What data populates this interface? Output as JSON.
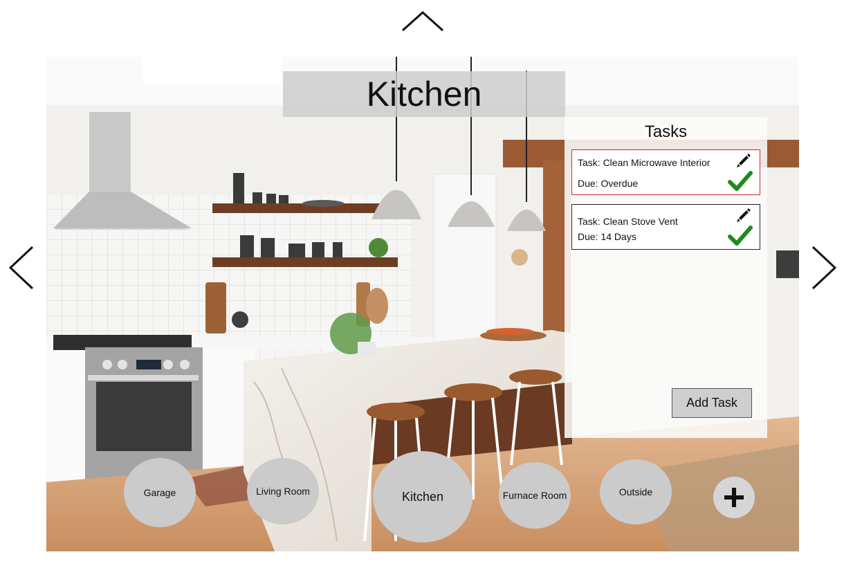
{
  "room": {
    "title": "Kitchen"
  },
  "tasks_panel": {
    "title": "Tasks",
    "items": [
      {
        "task": "Task: Clean Microwave Interior",
        "due": "Due: Overdue",
        "status": "overdue"
      },
      {
        "task": "Task: Clean Stove Vent",
        "due": "Due: 14 Days",
        "status": "normal"
      }
    ],
    "add_label": "Add Task"
  },
  "rooms": [
    {
      "label": "Garage"
    },
    {
      "label": "Living Room"
    },
    {
      "label": "Kitchen",
      "active": true
    },
    {
      "label": "Furnace Room"
    },
    {
      "label": "Outside"
    }
  ],
  "icons": {
    "up": "chevron-up-icon",
    "left": "chevron-left-icon",
    "right": "chevron-right-icon",
    "edit": "pencil-icon",
    "check": "check-icon",
    "add": "plus-icon"
  },
  "colors": {
    "overdue_border": "#d9232b",
    "check": "#1f8a1f",
    "bubble": "#cbcbcb"
  }
}
